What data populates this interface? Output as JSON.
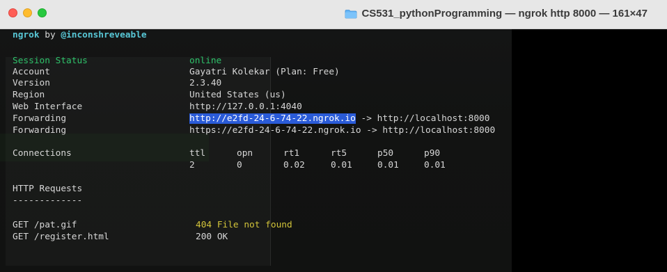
{
  "window": {
    "title": "CS531_pythonProgramming — ngrok http 8000 — 161×47",
    "folder_icon": "folder-icon"
  },
  "header": {
    "app": "ngrok",
    "by": " by ",
    "handle": "@inconshreveable"
  },
  "session": [
    {
      "label": "Session Status",
      "value": "online"
    },
    {
      "label": "Account",
      "value": "Gayatri Kolekar (Plan: Free)"
    },
    {
      "label": "Version",
      "value": "2.3.40"
    },
    {
      "label": "Region",
      "value": "United States (us)"
    },
    {
      "label": "Web Interface",
      "value": "http://127.0.0.1:4040"
    },
    {
      "label": "Forwarding",
      "value_highlight": "http://e2fd-24-6-74-22.ngrok.io",
      "value_rest": " -> http://localhost:8000"
    },
    {
      "label": "Forwarding",
      "value": "https://e2fd-24-6-74-22.ngrok.io -> http://localhost:8000"
    }
  ],
  "connections": {
    "label": "Connections",
    "headers": [
      "ttl",
      "opn",
      "rt1",
      "rt5",
      "p50",
      "p90"
    ],
    "values": [
      "2",
      "0",
      "0.02",
      "0.01",
      "0.01",
      "0.01"
    ]
  },
  "http": {
    "title": "HTTP Requests",
    "rule": "-------------",
    "requests": [
      {
        "request": "GET /pat.gif",
        "status": "404 File not found"
      },
      {
        "request": "GET /register.html",
        "status": "200 OK"
      }
    ]
  },
  "colors": {
    "terminal_bg": "#0d0d0d",
    "online": "#2ec26a",
    "header_cyan": "#58c7d6",
    "highlight": "#2a5bd8",
    "status_404": "#d2c43a"
  }
}
